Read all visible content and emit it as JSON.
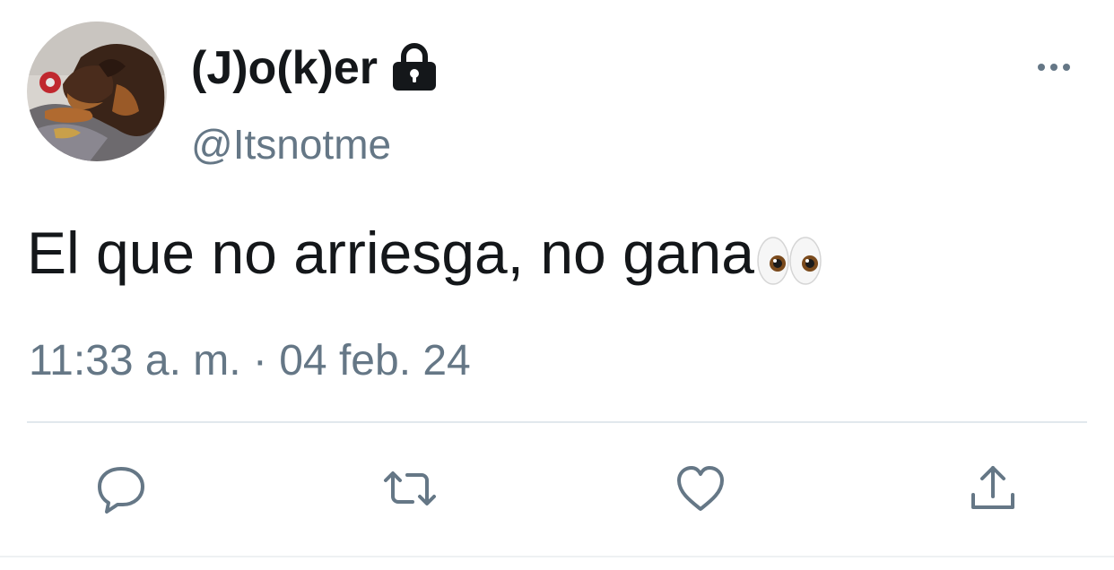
{
  "tweet": {
    "display_name": "(J)o(k)er",
    "handle": "@Itsnotme",
    "text": "El que no arriesga, no gana",
    "timestamp": "11:33 a. m. · 04 feb. 24",
    "protected_icon": "lock-icon",
    "emoji": "eyes-emoji"
  },
  "actions": [
    {
      "name": "reply",
      "icon": "reply-icon"
    },
    {
      "name": "retweet",
      "icon": "retweet-icon"
    },
    {
      "name": "like",
      "icon": "heart-icon"
    },
    {
      "name": "share",
      "icon": "share-icon"
    }
  ],
  "colors": {
    "text_primary": "#14171a",
    "text_secondary": "#657786",
    "icon_gray": "#657786",
    "divider": "#e1e8ed",
    "background": "#ffffff"
  }
}
